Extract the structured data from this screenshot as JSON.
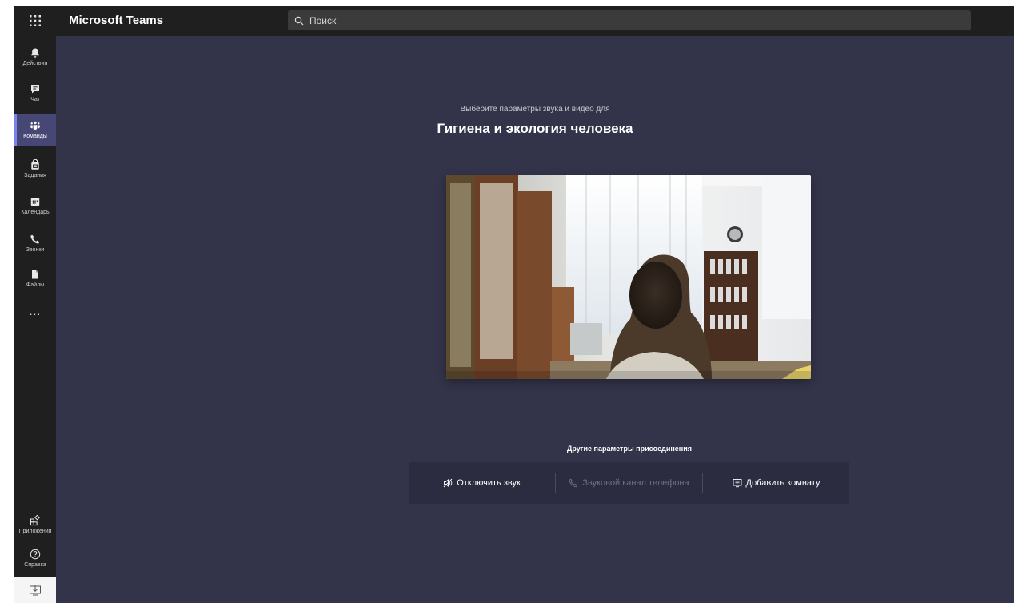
{
  "app": {
    "title": "Microsoft Teams"
  },
  "search": {
    "placeholder": "Поиск",
    "icon": "search-icon"
  },
  "rail": {
    "items": [
      {
        "label": "Действия",
        "icon": "bell-icon",
        "active": false
      },
      {
        "label": "Чат",
        "icon": "chat-icon",
        "active": false
      },
      {
        "label": "Команды",
        "icon": "teams-icon",
        "active": true
      },
      {
        "label": "Задания",
        "icon": "assignments-icon",
        "active": false
      },
      {
        "label": "Календарь",
        "icon": "calendar-icon",
        "active": false
      },
      {
        "label": "Звонки",
        "icon": "phone-icon",
        "active": false
      },
      {
        "label": "Файлы",
        "icon": "files-icon",
        "active": false
      }
    ],
    "more": "...",
    "bottom": [
      {
        "label": "Приложения",
        "icon": "apps-icon"
      },
      {
        "label": "Справка",
        "icon": "help-icon"
      }
    ],
    "download_icon": "download-icon"
  },
  "prejoin": {
    "subtitle": "Выберите параметры звука и видео для",
    "meeting_title": "Гигиена и экология человека",
    "other_options_label": "Другие параметры присоединения",
    "options": [
      {
        "label": "Отключить звук",
        "icon": "speaker-off-icon",
        "enabled": true
      },
      {
        "label": "Звуковой канал телефона",
        "icon": "phone-icon",
        "enabled": false
      },
      {
        "label": "Добавить комнату",
        "icon": "cast-room-icon",
        "enabled": true
      }
    ]
  },
  "colors": {
    "app_background": "#33344a",
    "rail_background": "#1f1f1f",
    "active_item": "#464775",
    "accent": "#7b83eb"
  }
}
